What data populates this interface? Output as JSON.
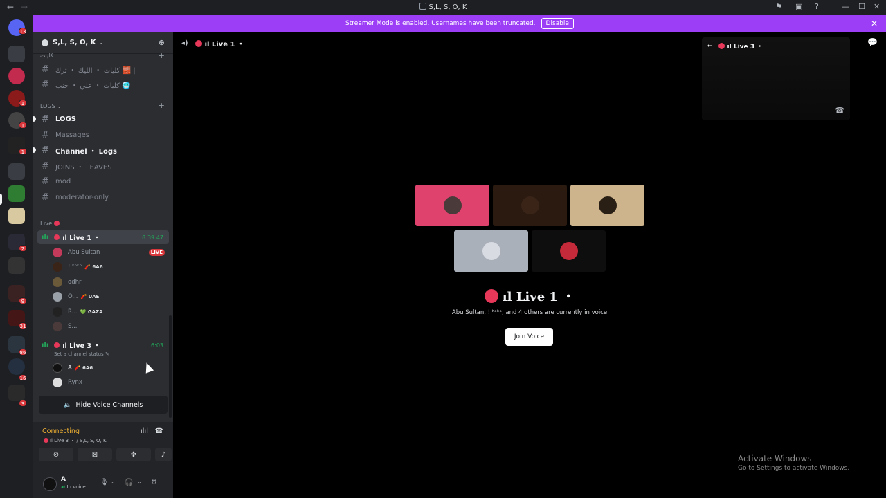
{
  "window": {
    "title": "S,L, S, O, K",
    "back_icon": "arrow-left-icon",
    "forward_icon": "arrow-right-icon",
    "controls": [
      "inbox-icon",
      "screen-icon",
      "help-icon",
      "minimize-icon",
      "maximize-icon",
      "close-icon"
    ]
  },
  "banner": {
    "text": "Streamer Mode is enabled. Usernames have been truncated.",
    "button": "Disable",
    "color": "#9b3ef6"
  },
  "servers": {
    "badges": [
      "13",
      "1",
      "1",
      "1",
      "1",
      "2",
      "9",
      "31",
      "86",
      "16",
      "3"
    ]
  },
  "guild": {
    "name": "S,L, S, O, K",
    "categories": {
      "top_partial": "كليات",
      "logs": "LOGS",
      "live": "Live"
    },
    "text_channels_top": [
      {
        "name": "كليات ・ الليك ・ ترك 🧱 |"
      },
      {
        "name": "كليات ・ علي ・ جنب 🥶 |"
      }
    ],
    "log_channels": [
      {
        "name": "LOGS",
        "unread": true
      },
      {
        "name": "Massages",
        "unread": false
      },
      {
        "name": "Channel ・ Logs",
        "unread": true
      },
      {
        "name": "JOINS ・ LEAVES",
        "unread": false
      },
      {
        "name": "mod",
        "unread": false
      },
      {
        "name": "moderator-only",
        "unread": false
      }
    ],
    "voice_channels": [
      {
        "name": "ıl Live 1 ・",
        "timer": "8:39:47",
        "users": [
          {
            "name": "Abu Sultan",
            "tag": "",
            "live": "LIVE"
          },
          {
            "name": "! ᴷᵒᵏᵒ",
            "tag": "🧨 6A6"
          },
          {
            "name": "odhr",
            "tag": ""
          },
          {
            "name": "O...",
            "tag": "🧨 UAE"
          },
          {
            "name": "R...",
            "tag": "💚 GAZA"
          },
          {
            "name": "S...",
            "tag": ""
          }
        ]
      },
      {
        "name": "ıl Live 3 ・",
        "timer": "6:03",
        "status": "Set a channel status",
        "users": [
          {
            "name": "A",
            "tag": "🧨 6A6"
          },
          {
            "name": "Rynx",
            "tag": ""
          }
        ]
      }
    ],
    "hide_button": "Hide Voice Channels"
  },
  "voice_panel": {
    "status": "Connecting",
    "location": "ıl Live 3 ・ / S,L, S, O, K",
    "actions": [
      "camera-off-icon",
      "screen-share-icon",
      "activities-icon",
      "soundboard-icon"
    ]
  },
  "user": {
    "name": "A",
    "status": "In voice"
  },
  "main": {
    "channel_title": "ıl Live 1 ・",
    "pip_title": "ıl Live 3 ・",
    "big_title": "ıl Live 1 ・",
    "subtitle": "Abu Sultan, ! ᴷᵒᵏᵒ, and 4 others are currently in voice",
    "join_button": "Join Voice",
    "tile_colors": [
      "#e0426e",
      "#2a1a10",
      "#cdb48c",
      "#aab0ba",
      "#0e0e0e"
    ]
  },
  "watermark": {
    "line1": "Activate Windows",
    "line2": "Go to Settings to activate Windows."
  }
}
